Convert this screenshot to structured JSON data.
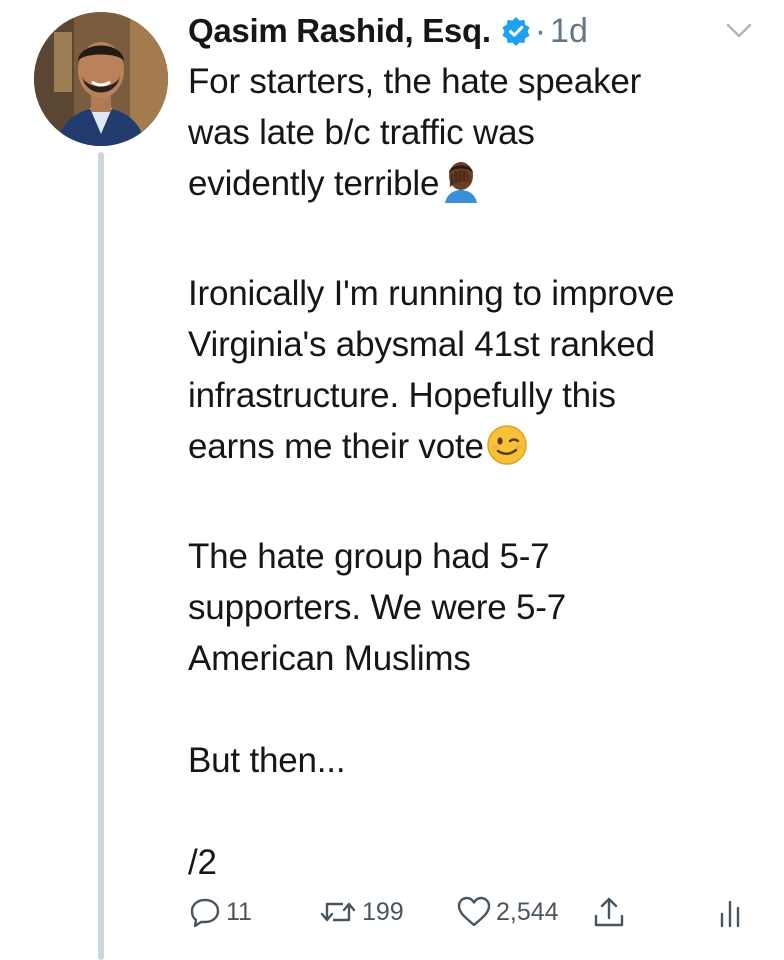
{
  "tweet": {
    "display_name": "Qasim Rashid, Esq.",
    "verified_icon": "verified-badge-icon",
    "separator": "·",
    "timestamp": "1d",
    "paragraphs": [
      [
        "For starters, the hate speaker",
        "was late b/c traffic was",
        "evidently terrible"
      ],
      [
        "Ironically I'm running to improve",
        "Virginia's abysmal 41st ranked",
        "infrastructure. Hopefully this",
        "earns me their vote"
      ],
      [
        "The hate group had 5-7",
        "supporters. We were 5-7",
        "American Muslims"
      ],
      [
        "But then..."
      ],
      [
        "/2"
      ]
    ],
    "emojis": {
      "facepalm": "facepalm-emoji",
      "wink": "winking-face-emoji"
    }
  },
  "actions": {
    "reply_count": "11",
    "retweet_count": "199",
    "like_count": "2,544"
  },
  "colors": {
    "accent": "#1da1f2",
    "muted": "#657786",
    "thread_line": "#ccd6dd"
  }
}
